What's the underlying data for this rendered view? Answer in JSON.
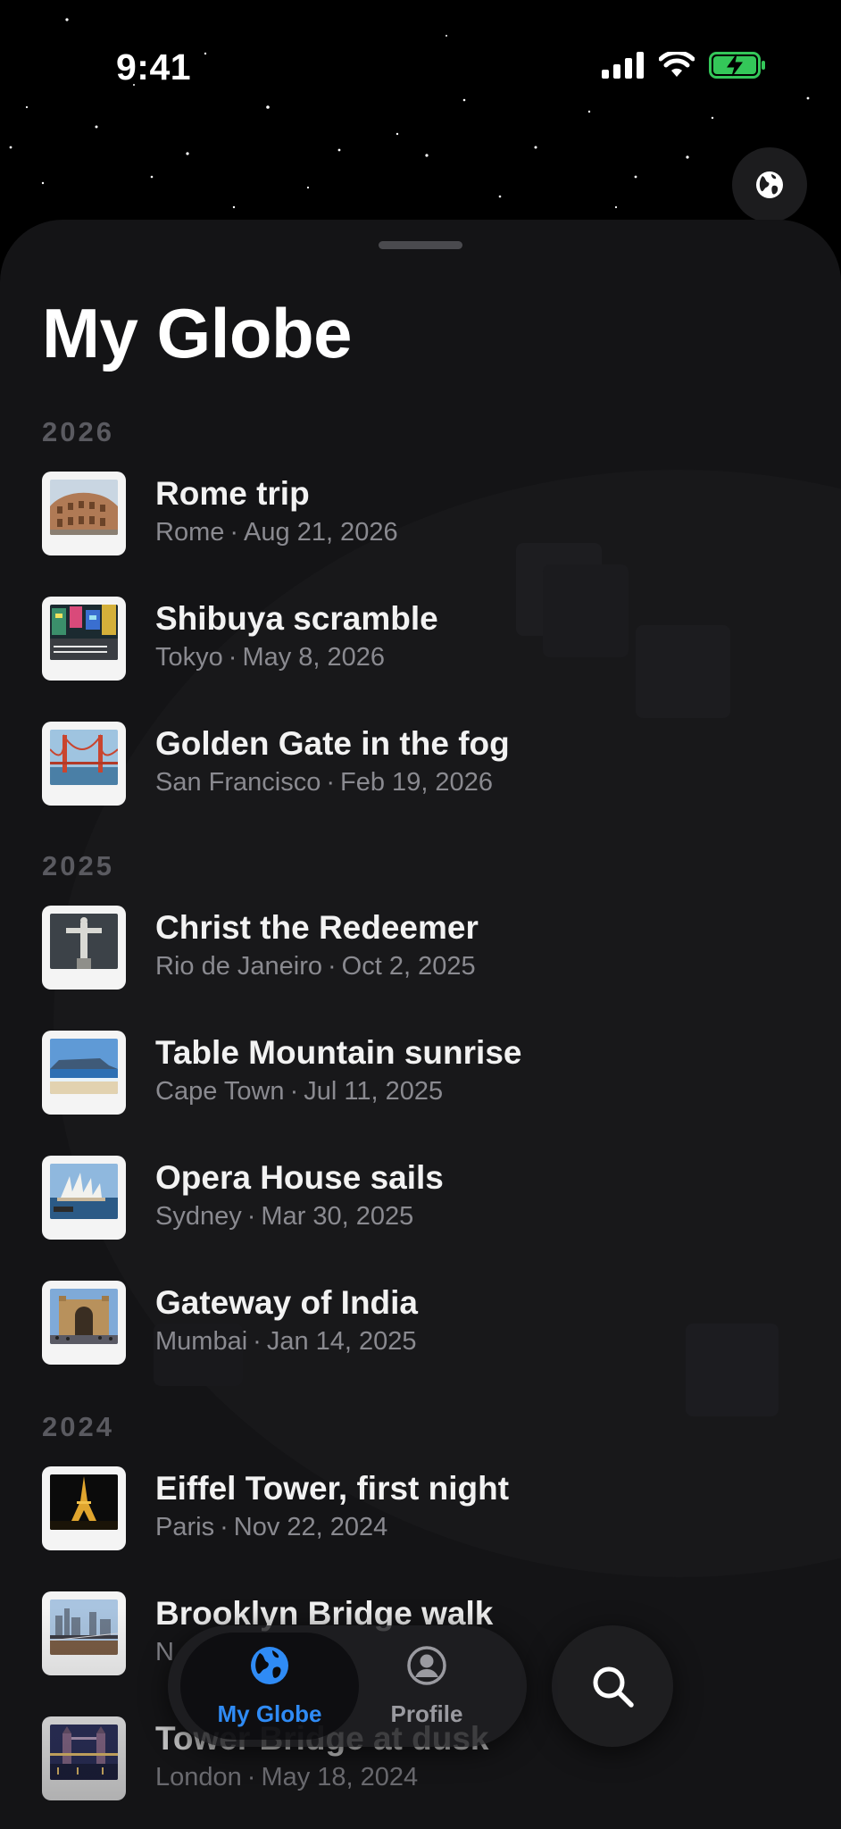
{
  "status": {
    "time": "9:41"
  },
  "sheet": {
    "title": "My Globe"
  },
  "years": [
    "2026",
    "2025",
    "2024"
  ],
  "entries": [
    {
      "title": "Rome trip",
      "place": "Rome",
      "date": "Aug 21, 2026",
      "thumb": "colosseum-photo"
    },
    {
      "title": "Shibuya scramble",
      "place": "Tokyo",
      "date": "May 8, 2026",
      "thumb": "shibuya-photo"
    },
    {
      "title": "Golden Gate in the fog",
      "place": "San Francisco",
      "date": "Feb 19, 2026",
      "thumb": "golden-gate-photo"
    },
    {
      "title": "Christ the Redeemer",
      "place": "Rio de Janeiro",
      "date": "Oct 2, 2025",
      "thumb": "christ-redeemer-photo"
    },
    {
      "title": "Table Mountain sunrise",
      "place": "Cape Town",
      "date": "Jul 11, 2025",
      "thumb": "table-mountain-photo"
    },
    {
      "title": "Opera House sails",
      "place": "Sydney",
      "date": "Mar 30, 2025",
      "thumb": "opera-house-photo"
    },
    {
      "title": "Gateway of India",
      "place": "Mumbai",
      "date": "Jan 14, 2025",
      "thumb": "gateway-india-photo"
    },
    {
      "title": "Eiffel Tower, first night",
      "place": "Paris",
      "date": "Nov 22, 2024",
      "thumb": "eiffel-tower-photo"
    },
    {
      "title": "Brooklyn Bridge walk",
      "place": "N",
      "date": "",
      "thumb": "brooklyn-bridge-photo"
    },
    {
      "title": "Tower Bridge at dusk",
      "place": "London",
      "date": "May 18, 2024",
      "thumb": "tower-bridge-photo"
    }
  ],
  "separator": "·",
  "tabbar": {
    "tabs": [
      {
        "label": "My Globe",
        "icon": "globe-icon",
        "active": true
      },
      {
        "label": "Profile",
        "icon": "person-circle-icon",
        "active": false
      }
    ],
    "search_icon": "search-icon"
  },
  "colors": {
    "accent": "#2f8bf5",
    "background": "#000000",
    "sheet": "#141416",
    "secondary_text": "#8a8a90",
    "year_header": "#5a5a60",
    "battery": "#34c759"
  }
}
